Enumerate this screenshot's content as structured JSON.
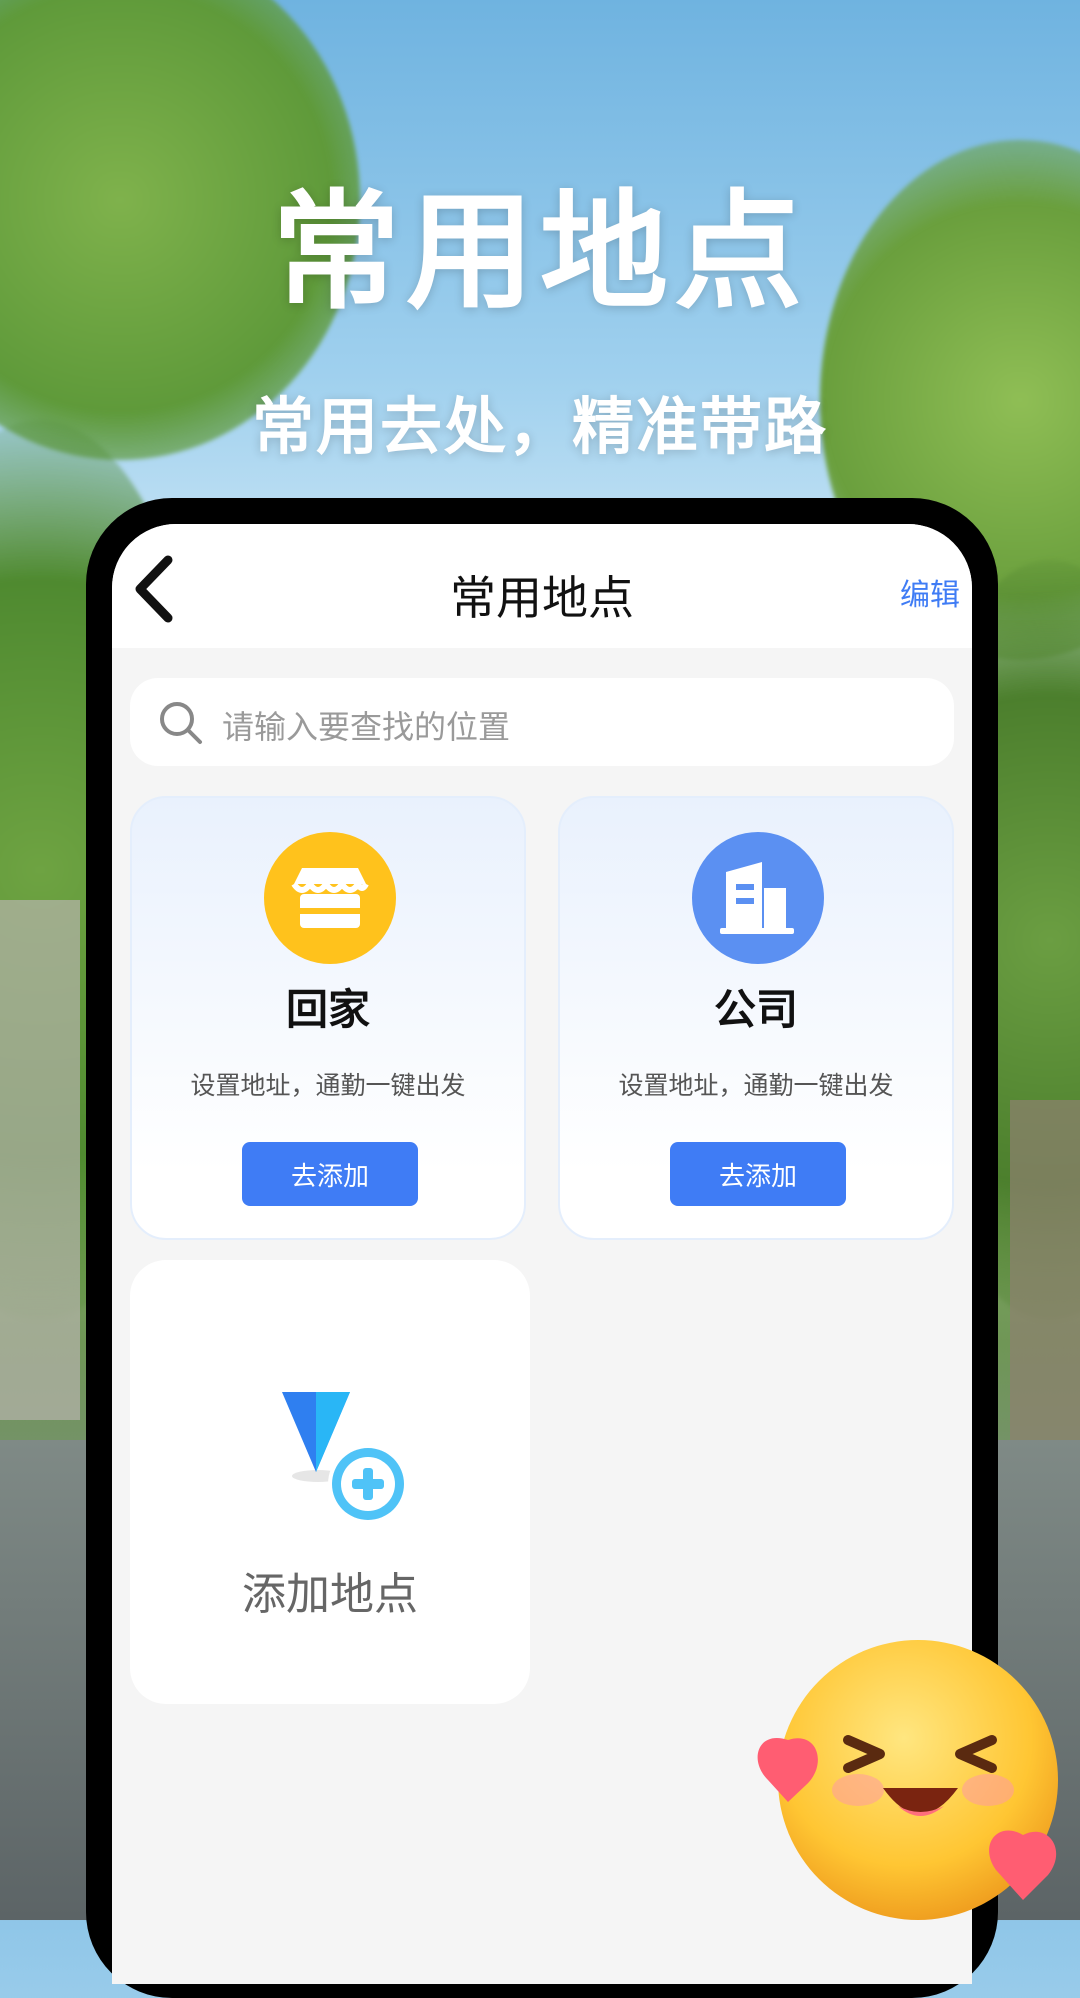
{
  "hero": {
    "title": "常用地点",
    "subtitle": "常用去处，精准带路"
  },
  "navbar": {
    "title": "常用地点",
    "edit_label": "编辑"
  },
  "search": {
    "placeholder": "请输入要查找的位置"
  },
  "cards": [
    {
      "name": "回家",
      "desc": "设置地址，通勤一键出发",
      "button": "去添加",
      "icon": "store-icon",
      "icon_color": "#ffc21c"
    },
    {
      "name": "公司",
      "desc": "设置地址，通勤一键出发",
      "button": "去添加",
      "icon": "building-icon",
      "icon_color": "#5b90f2"
    }
  ],
  "add_place": {
    "label": "添加地点",
    "icon": "location-add-icon"
  },
  "colors": {
    "accent": "#3f7cf5"
  }
}
